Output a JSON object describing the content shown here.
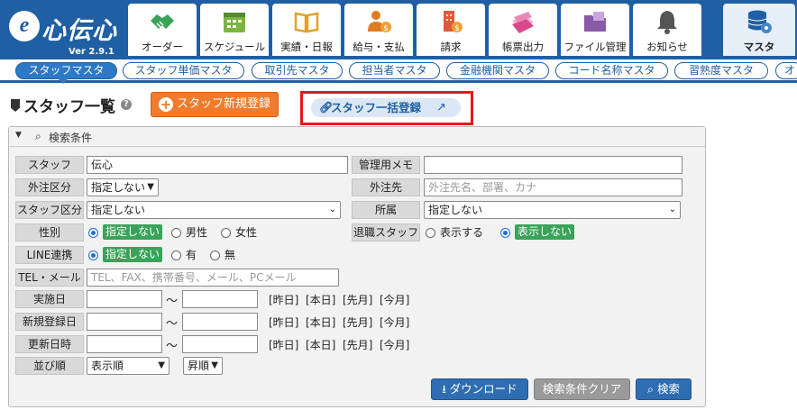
{
  "app": {
    "logo_text": "心伝心",
    "logo_mark": "e",
    "version": "Ver 2.9.1"
  },
  "top_tabs": [
    {
      "label": "オーダー",
      "icon": "handshake-icon",
      "color": "#3aa35a"
    },
    {
      "label": "スケジュール",
      "icon": "calendar-icon",
      "color": "#7cb342"
    },
    {
      "label": "実績・日報",
      "icon": "book-icon",
      "color": "#e0a322"
    },
    {
      "label": "給与・支払",
      "icon": "person-money-icon",
      "color": "#e07b22"
    },
    {
      "label": "請求",
      "icon": "building-money-icon",
      "color": "#e05a3a"
    },
    {
      "label": "帳票出力",
      "icon": "documents-icon",
      "color": "#d94a8c"
    },
    {
      "label": "ファイル管理",
      "icon": "folder-icon",
      "color": "#8a5aa8"
    },
    {
      "label": "お知らせ",
      "icon": "bell-icon",
      "color": "#555555"
    },
    {
      "label": "マスタ",
      "icon": "database-gear-icon",
      "color": "#1f5fa3",
      "active": true
    }
  ],
  "sub_tabs": [
    {
      "label": "スタッフマスタ",
      "active": true
    },
    {
      "label": "スタッフ単価マスタ"
    },
    {
      "label": "取引先マスタ"
    },
    {
      "label": "担当者マスタ"
    },
    {
      "label": "金融機関マスタ"
    },
    {
      "label": "コード名称マスタ"
    },
    {
      "label": "習熟度マスタ"
    },
    {
      "label": "オ"
    }
  ],
  "page": {
    "title": "スタッフ一覧",
    "new_button": "スタッフ新規登録",
    "bulk_button": "スタッフ一括登録"
  },
  "search": {
    "header": "検索条件",
    "staff_label": "スタッフ",
    "staff_value": "伝心",
    "memo_label": "管理用メモ",
    "memo_value": "",
    "outsource_type_label": "外注区分",
    "outsource_type_value": "指定しない",
    "outsource_label": "外注先",
    "outsource_placeholder": "外注先名、部署、カナ",
    "staff_type_label": "スタッフ区分",
    "staff_type_value": "指定しない",
    "affiliation_label": "所属",
    "affiliation_value": "指定しない",
    "gender_label": "性別",
    "gender_options": [
      "指定しない",
      "男性",
      "女性"
    ],
    "retired_label": "退職スタッフ",
    "retired_options": [
      "表示する",
      "表示しない"
    ],
    "line_label": "LINE連携",
    "line_options": [
      "指定しない",
      "有",
      "無"
    ],
    "tel_label": "TEL・メール",
    "tel_placeholder": "TEL、FAX、携帯番号、メール、PCメール",
    "date_rows": [
      {
        "label": "実施日"
      },
      {
        "label": "新規登録日"
      },
      {
        "label": "更新日時"
      }
    ],
    "quick_links": [
      "[昨日]",
      "[本日]",
      "[先月]",
      "[今月]"
    ],
    "tilde": "～",
    "order_label": "並び順",
    "order_value": "表示順",
    "direction_value": "昇順",
    "download_button": "ダウンロード",
    "clear_button": "検索条件クリア",
    "search_button": "検索"
  }
}
